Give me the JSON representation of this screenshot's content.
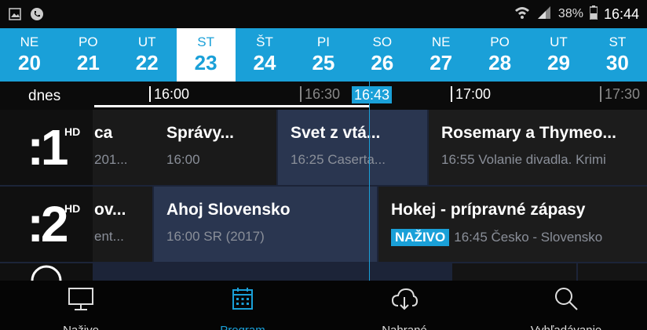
{
  "status": {
    "battery": "38%",
    "time": "16:44"
  },
  "dates": [
    {
      "dow": "NE",
      "num": "20"
    },
    {
      "dow": "PO",
      "num": "21"
    },
    {
      "dow": "UT",
      "num": "22"
    },
    {
      "dow": "ST",
      "num": "23"
    },
    {
      "dow": "ŠT",
      "num": "24"
    },
    {
      "dow": "PI",
      "num": "25"
    },
    {
      "dow": "SO",
      "num": "26"
    },
    {
      "dow": "NE",
      "num": "27"
    },
    {
      "dow": "PO",
      "num": "28"
    },
    {
      "dow": "UT",
      "num": "29"
    },
    {
      "dow": "ST",
      "num": "30"
    }
  ],
  "timeline": {
    "today": "dnes",
    "t1600": "16:00",
    "t1630": "16:30",
    "now": "16:43",
    "t1700": "17:00",
    "t1730": "17:30"
  },
  "channels": [
    {
      "logo": ":1",
      "hd": "HD",
      "programs": [
        {
          "title": "ca",
          "sub": "201..."
        },
        {
          "title": "Správy...",
          "sub": "16:00"
        },
        {
          "title": "Svet z vtá...",
          "sub": "16:25 Caserta..."
        },
        {
          "title": "Rosemary a Thymeo...",
          "sub": "16:55 Volanie divadla. Krimi"
        }
      ]
    },
    {
      "logo": ":2",
      "hd": "HD",
      "programs": [
        {
          "title": "ov...",
          "sub": "ent..."
        },
        {
          "title": "Ahoj Slovensko",
          "sub": "16:00 SR (2017)"
        },
        {
          "title": "Hokej - prípravné zápasy",
          "live": "NAŽIVO",
          "sub": "16:45 Česko - Slovensko"
        }
      ]
    }
  ],
  "nav": [
    {
      "label": "Naživo",
      "icon": "tv-icon"
    },
    {
      "label": "Program",
      "icon": "calendar-icon"
    },
    {
      "label": "Nahrané",
      "icon": "cloud-download-icon"
    },
    {
      "label": "Vyhľadávanie",
      "icon": "search-icon"
    }
  ],
  "colors": {
    "accent": "#1aa0d8",
    "grid_bg": "#1c2438"
  }
}
